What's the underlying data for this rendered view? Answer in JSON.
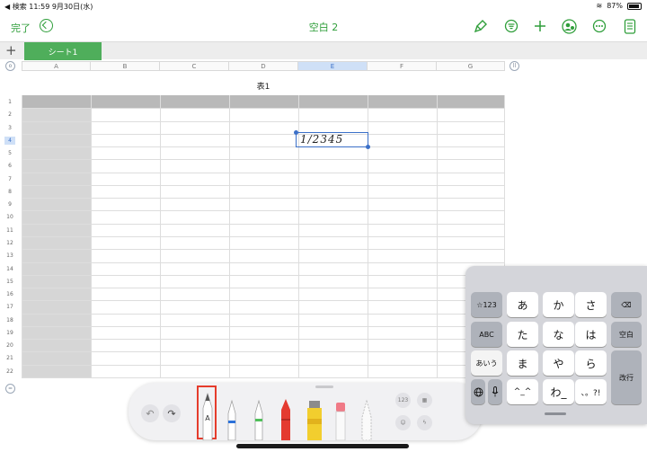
{
  "status": {
    "left": "◀ 検索   11:59   9月30日(水)",
    "battery": "87%"
  },
  "toolbar": {
    "done": "完了",
    "title": "空白 2"
  },
  "sheets": {
    "active": "シート1"
  },
  "columns": [
    "A",
    "B",
    "C",
    "D",
    "E",
    "F",
    "G"
  ],
  "selected_column": "E",
  "table": {
    "title": "表1",
    "rows": [
      "1",
      "2",
      "3",
      "4",
      "5",
      "6",
      "7",
      "8",
      "9",
      "10",
      "11",
      "12",
      "13",
      "14",
      "15",
      "16",
      "17",
      "18",
      "19",
      "20",
      "21",
      "22"
    ],
    "selected_row": "4"
  },
  "cell": {
    "handwriting": "1/2345"
  },
  "icons": {
    "undo": "undo-circle-icon",
    "brush": "paintbrush-icon",
    "filter": "filter-icon",
    "add": "plus-icon",
    "collab": "collaborate-icon",
    "more": "ellipsis-icon",
    "doc": "document-icon"
  },
  "palette": {
    "num_label": "123",
    "selected_tool_label": "A"
  },
  "keyboard": {
    "row1": [
      "☆123",
      "あ",
      "か",
      "さ"
    ],
    "row2": [
      "ABC",
      "た",
      "な",
      "は",
      "空白"
    ],
    "row3": [
      "あいう",
      "ま",
      "や",
      "ら",
      "改行"
    ],
    "row4": [
      "^_^",
      "わ_",
      "、。?!"
    ]
  },
  "colors": {
    "accent": "#2f9e3a",
    "tab": "#4fae5b",
    "selection": "#3b70c8",
    "tool_highlight": "#e53c2c"
  }
}
